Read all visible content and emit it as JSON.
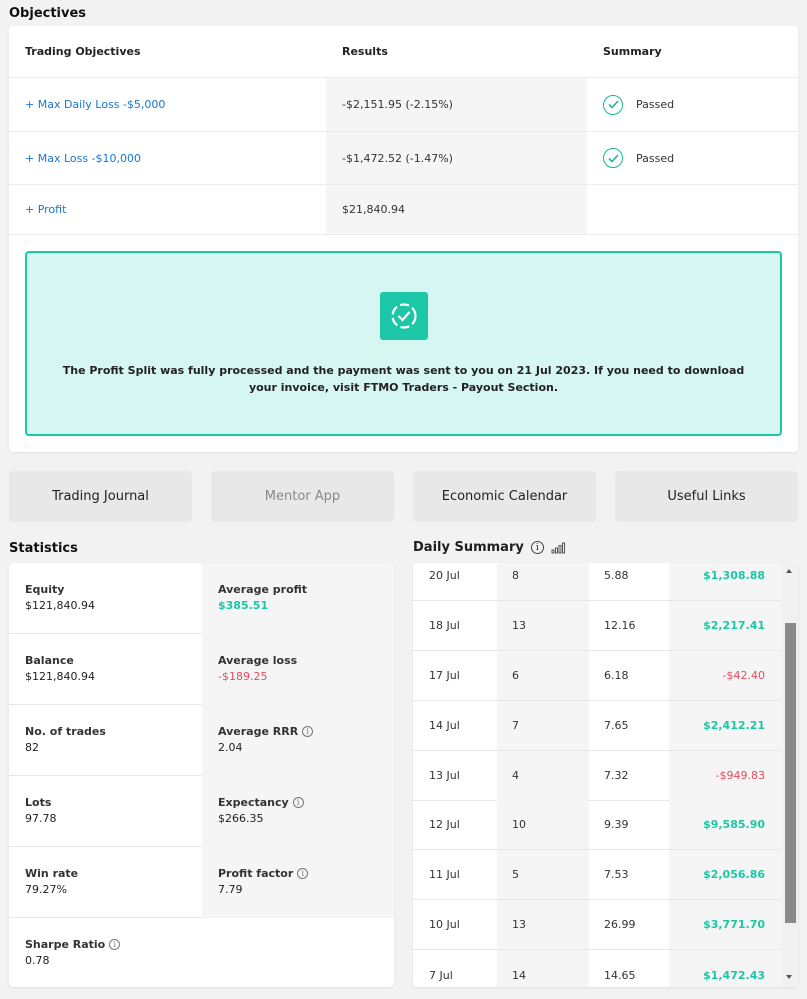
{
  "objectives": {
    "title": "Objectives",
    "headers": [
      "Trading Objectives",
      "Results",
      "Summary"
    ],
    "rows": [
      {
        "objective": "+ Max Daily Loss -$5,000",
        "result": "-$2,151.95 (-2.15%)",
        "summary": "Passed"
      },
      {
        "objective": "+ Max Loss -$10,000",
        "result": "-$1,472.52 (-1.47%)",
        "summary": "Passed"
      },
      {
        "objective": "+ Profit",
        "result": "$21,840.94",
        "summary": ""
      }
    ],
    "banner_text": "The Profit Split was fully processed and the payment was sent to you on 21 Jul 2023. If you need to download your invoice, visit FTMO Traders - Payout Section."
  },
  "buttons": [
    "Trading Journal",
    "Mentor App",
    "Economic Calendar",
    "Useful Links"
  ],
  "statistics": {
    "title": "Statistics",
    "rows": [
      [
        {
          "label": "Equity",
          "value": "$121,840.94"
        },
        {
          "label": "Average profit",
          "value": "$385.51",
          "tone": "positive"
        }
      ],
      [
        {
          "label": "Balance",
          "value": "$121,840.94"
        },
        {
          "label": "Average loss",
          "value": "-$189.25",
          "tone": "negative"
        }
      ],
      [
        {
          "label": "No. of trades",
          "value": "82"
        },
        {
          "label": "Average RRR",
          "value": "2.04",
          "info": true
        }
      ],
      [
        {
          "label": "Lots",
          "value": "97.78"
        },
        {
          "label": "Expectancy",
          "value": "$266.35",
          "info": true
        }
      ],
      [
        {
          "label": "Win rate",
          "value": "79.27%"
        },
        {
          "label": "Profit factor",
          "value": "7.79",
          "info": true
        }
      ],
      [
        {
          "label": "Sharpe Ratio",
          "value": "0.78",
          "info": true
        }
      ]
    ]
  },
  "daily_summary": {
    "title": "Daily Summary",
    "rows": [
      {
        "date": "20 Jul",
        "trades": "8",
        "lots": "5.88",
        "result": "$1,308.88",
        "tone": "positive"
      },
      {
        "date": "18 Jul",
        "trades": "13",
        "lots": "12.16",
        "result": "$2,217.41",
        "tone": "positive"
      },
      {
        "date": "17 Jul",
        "trades": "6",
        "lots": "6.18",
        "result": "-$42.40",
        "tone": "negative"
      },
      {
        "date": "14 Jul",
        "trades": "7",
        "lots": "7.65",
        "result": "$2,412.21",
        "tone": "positive"
      },
      {
        "date": "13 Jul",
        "trades": "4",
        "lots": "7.32",
        "result": "-$949.83",
        "tone": "negative"
      },
      {
        "date": "12 Jul",
        "trades": "10",
        "lots": "9.39",
        "result": "$9,585.90",
        "tone": "positive"
      },
      {
        "date": "11 Jul",
        "trades": "5",
        "lots": "7.53",
        "result": "$2,056.86",
        "tone": "positive"
      },
      {
        "date": "10 Jul",
        "trades": "13",
        "lots": "26.99",
        "result": "$3,771.70",
        "tone": "positive"
      },
      {
        "date": "7 Jul",
        "trades": "14",
        "lots": "14.65",
        "result": "$1,472.43",
        "tone": "positive"
      }
    ]
  },
  "colors": {
    "accent": "#1cc7a7",
    "link": "#1877d2",
    "negative": "#ee4861"
  },
  "icons": {
    "passed": "check-circle-icon",
    "banner": "dashed-check-circle-icon",
    "info": "info-icon",
    "chart": "bar-chart-icon"
  }
}
